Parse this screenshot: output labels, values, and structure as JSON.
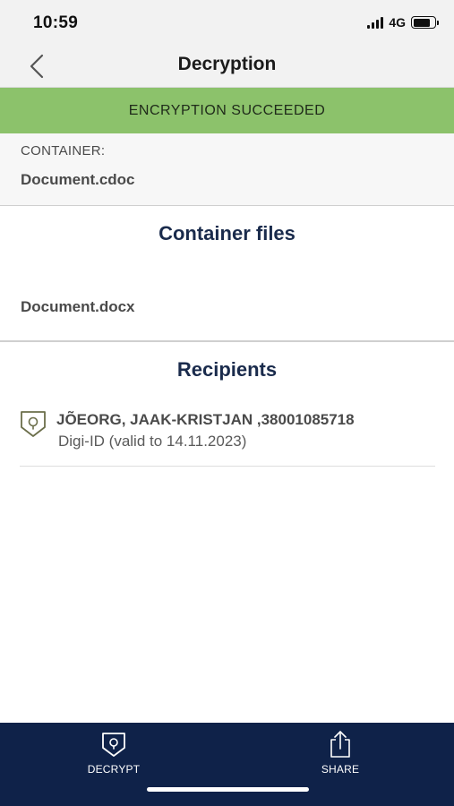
{
  "status_bar": {
    "time": "10:59",
    "network": "4G",
    "icons": [
      "signal-icon",
      "battery-icon"
    ]
  },
  "nav": {
    "title": "Decryption",
    "back_icon": "chevron-left-icon"
  },
  "banner": {
    "text": "ENCRYPTION SUCCEEDED",
    "color": "#8cc26b"
  },
  "container": {
    "label": "CONTAINER:",
    "name": "Document.cdoc"
  },
  "files": {
    "heading": "Container files",
    "items": [
      {
        "name": "Document.docx"
      }
    ]
  },
  "recipients": {
    "heading": "Recipients",
    "items": [
      {
        "name": "JÕEORG, JAAK-KRISTJAN ,38001085718",
        "detail": "Digi-ID (valid to 14.11.2023)",
        "icon": "shield-id-icon"
      }
    ]
  },
  "bottom_bar": {
    "color": "#0f2249",
    "tabs": [
      {
        "label": "DECRYPT",
        "icon": "decrypt-shield-icon"
      },
      {
        "label": "SHARE",
        "icon": "share-icon"
      }
    ]
  }
}
